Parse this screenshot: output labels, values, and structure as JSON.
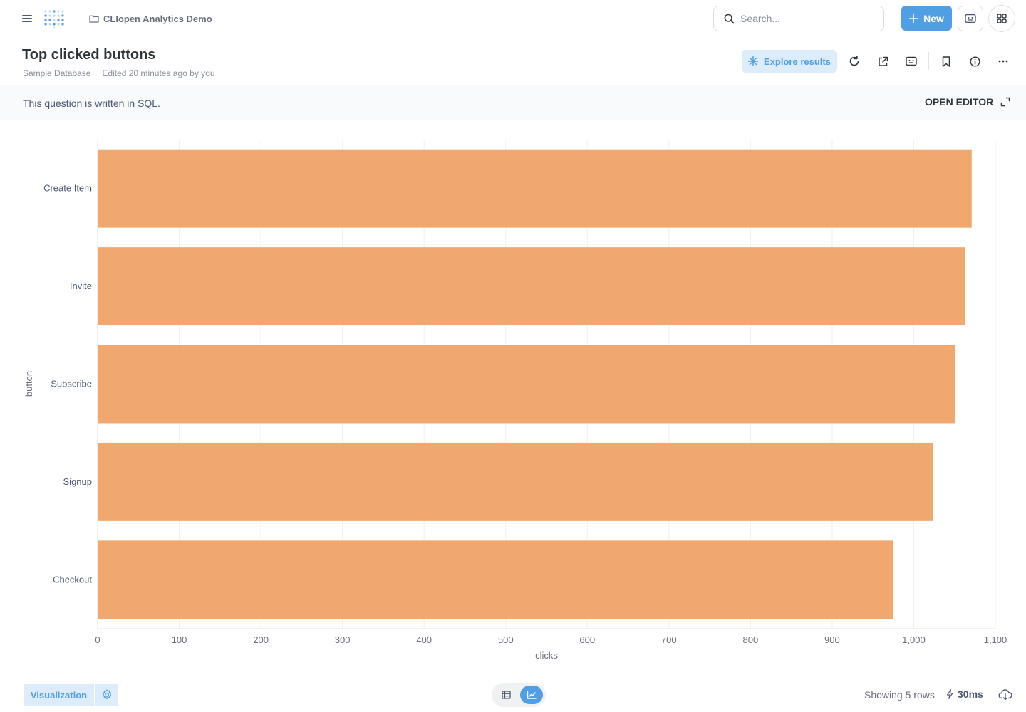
{
  "nav": {
    "collection": "CLIopen Analytics Demo",
    "search_placeholder": "Search...",
    "new_label": "New"
  },
  "question": {
    "title": "Top clicked buttons",
    "database": "Sample Database",
    "edited": "Edited 20 minutes ago by you",
    "explore_label": "Explore results"
  },
  "sql_bar": {
    "note": "This question is written in SQL.",
    "open_editor": "OPEN EDITOR"
  },
  "chart_data": {
    "type": "bar",
    "orientation": "horizontal",
    "categories": [
      "Create Item",
      "Invite",
      "Subscribe",
      "Signup",
      "Checkout"
    ],
    "values": [
      1071,
      1063,
      1051,
      1024,
      975
    ],
    "xlabel": "clicks",
    "ylabel": "button",
    "xlim": [
      0,
      1100
    ],
    "xticks": [
      "0",
      "100",
      "200",
      "300",
      "400",
      "500",
      "600",
      "700",
      "800",
      "900",
      "1,000",
      "1,100"
    ],
    "bar_color": "#f0a86e",
    "grid": true
  },
  "footer": {
    "visualization_label": "Visualization",
    "rows_text": "Showing 5 rows",
    "timing": "30ms"
  },
  "colors": {
    "accent": "#509ee3",
    "accent_light": "#ddecfa",
    "bar": "#f0a86e"
  }
}
